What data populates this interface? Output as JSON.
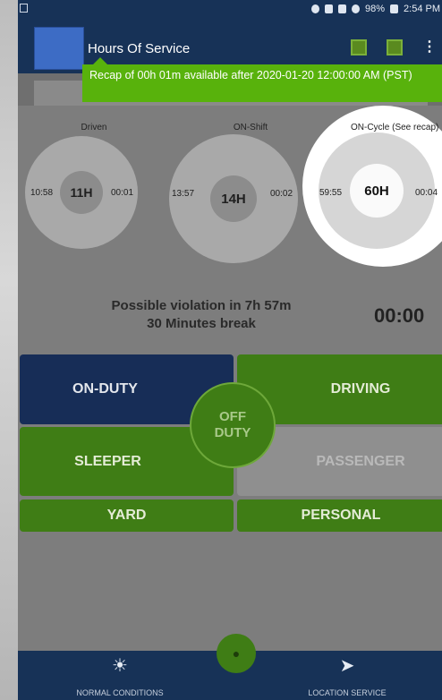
{
  "status_bar": {
    "battery": "98%",
    "time": "2:54 PM"
  },
  "app_bar": {
    "title": "Hours Of Service"
  },
  "recap_banner": {
    "text": "Recap of 00h 01m available after 2020-01-20 12:00:00 AM (PST)"
  },
  "gauges": [
    {
      "label": "Driven",
      "left": "10:58",
      "center": "11H",
      "right": "00:01"
    },
    {
      "label": "ON-Shift",
      "left": "13:57",
      "center": "14H",
      "right": "00:02"
    },
    {
      "label": "ON-Cycle (See recap)",
      "left": "59:55",
      "center": "60H",
      "right": "00:04"
    }
  ],
  "violation": {
    "line1": "Possible violation in 7h 57m",
    "line2": "30 Minutes break",
    "timer": "00:00"
  },
  "duty_buttons": {
    "on_duty": "ON-DUTY",
    "driving": "DRIVING",
    "off_duty": "OFF DUTY",
    "sleeper": "SLEEPER",
    "passenger": "PASSENGER",
    "yard": "YARD",
    "personal": "PERSONAL"
  },
  "bottom_nav": {
    "normal_conditions": "NORMAL CONDITIONS",
    "location_service": "LOCATION SERVICE"
  }
}
